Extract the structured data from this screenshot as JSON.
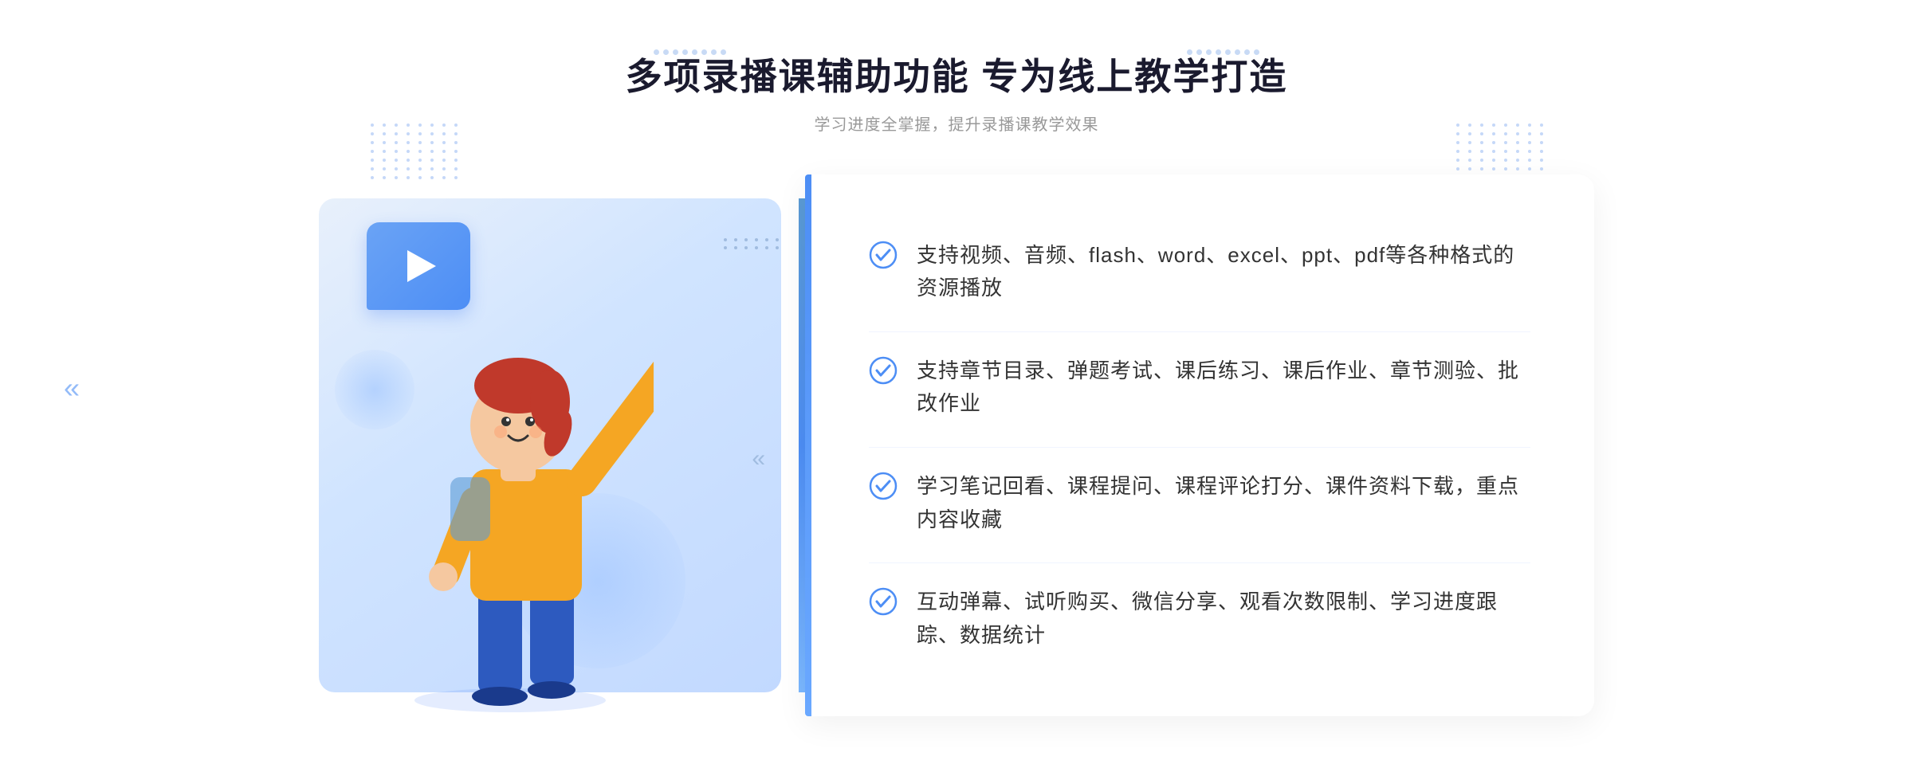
{
  "page": {
    "background_color": "#ffffff"
  },
  "header": {
    "main_title": "多项录播课辅助功能 专为线上教学打造",
    "sub_title": "学习进度全掌握，提升录播课教学效果"
  },
  "features": [
    {
      "id": "feature-1",
      "text": "支持视频、音频、flash、word、excel、ppt、pdf等各种格式的资源播放"
    },
    {
      "id": "feature-2",
      "text": "支持章节目录、弹题考试、课后练习、课后作业、章节测验、批改作业"
    },
    {
      "id": "feature-3",
      "text": "学习笔记回看、课程提问、课程评论打分、课件资料下载，重点内容收藏"
    },
    {
      "id": "feature-4",
      "text": "互动弹幕、试听购买、微信分享、观看次数限制、学习进度跟踪、数据统计"
    }
  ],
  "icons": {
    "check_color": "#4d8ef5",
    "arrow_left": "«",
    "play_color": "#4d8ef5"
  },
  "decoration": {
    "dots_color": "#c8daf5",
    "circle_color": "rgba(100,160,255,0.2)"
  }
}
